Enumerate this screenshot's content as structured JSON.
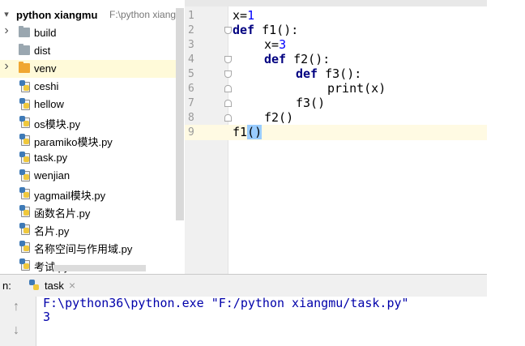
{
  "project": {
    "root_name": "python xiangmu",
    "root_path": "F:\\python xiang",
    "items": [
      {
        "label": "build",
        "type": "folder",
        "expandable": true
      },
      {
        "label": "dist",
        "type": "folder",
        "expandable": false
      },
      {
        "label": "venv",
        "type": "folder-orange",
        "expandable": true
      },
      {
        "label": "ceshi",
        "type": "py"
      },
      {
        "label": "hellow",
        "type": "py"
      },
      {
        "label": "os模块.py",
        "type": "py"
      },
      {
        "label": "paramiko模块.py",
        "type": "py"
      },
      {
        "label": "task.py",
        "type": "py"
      },
      {
        "label": "wenjian",
        "type": "py"
      },
      {
        "label": "yagmail模块.py",
        "type": "py"
      },
      {
        "label": "函数名片.py",
        "type": "py"
      },
      {
        "label": "名片.py",
        "type": "py"
      },
      {
        "label": "名称空间与作用域.py",
        "type": "py"
      },
      {
        "label": "考试.py",
        "type": "py"
      }
    ]
  },
  "editor": {
    "line_numbers": [
      "1",
      "2",
      "3",
      "4",
      "5",
      "6",
      "7",
      "8",
      "9"
    ],
    "lines": [
      {
        "kw": "",
        "text": "x=",
        "num": "1"
      },
      {
        "kw": "def",
        "text": " f1():"
      },
      {
        "kw": "",
        "text": "x=",
        "num": "3"
      },
      {
        "kw": "def",
        "text": " f2():"
      },
      {
        "kw": "def",
        "text": " f3():"
      },
      {
        "kw": "",
        "text": "print(x)"
      },
      {
        "kw": "",
        "text": "f3()"
      },
      {
        "kw": "",
        "text": "f2()"
      },
      {
        "kw": "",
        "text": "f1",
        "hl": "()"
      }
    ]
  },
  "run": {
    "label": "n:",
    "tab_name": "task",
    "close_glyph": "×",
    "up_glyph": "↑",
    "down_glyph": "↓",
    "command": "F:\\python36\\python.exe \"F:/python xiangmu/task.py\"",
    "output": "3"
  }
}
